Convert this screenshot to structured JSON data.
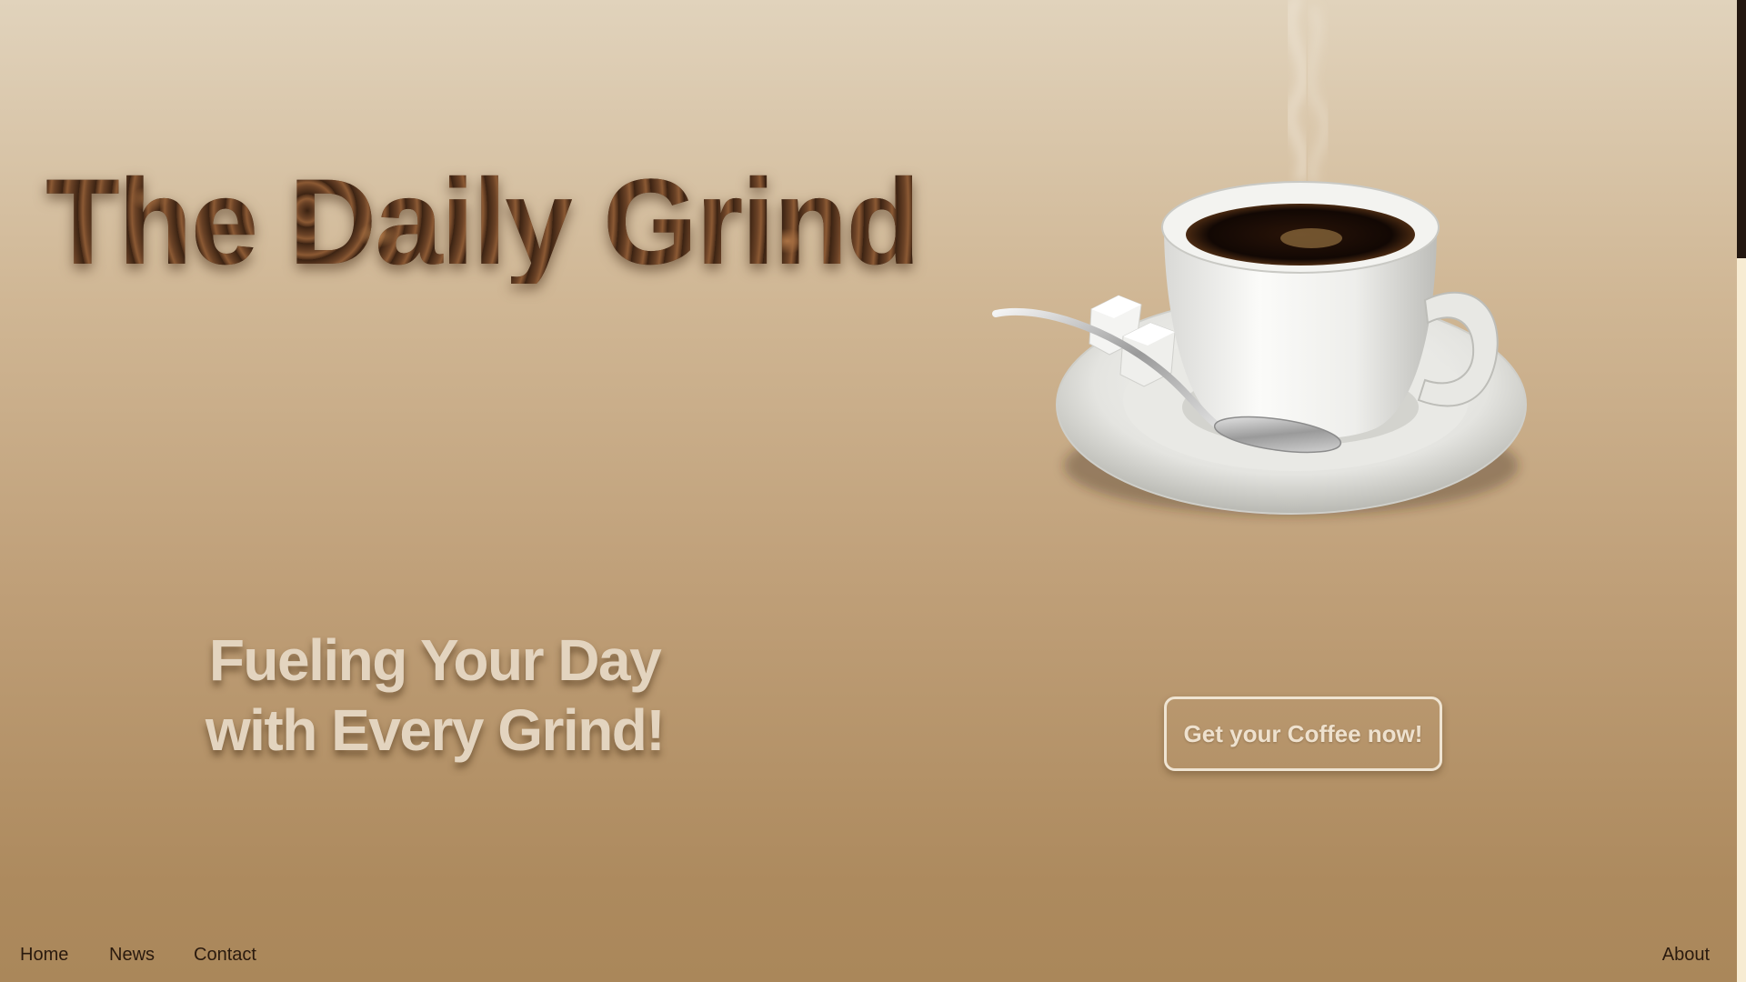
{
  "header": {
    "title": "The Daily Grind"
  },
  "hero": {
    "tagline_line1": "Fueling Your Day",
    "tagline_line2": "with Every Grind!",
    "cta_label": "Get your Coffee now!",
    "image": "coffee-cup-with-saucer-spoon-and-sugar-cubes"
  },
  "nav": {
    "items": [
      {
        "label": "Home"
      },
      {
        "label": "News"
      },
      {
        "label": "Contact"
      },
      {
        "label": "About"
      }
    ]
  },
  "colors": {
    "background_top": "#e1d3bc",
    "background_bottom": "#aa875a",
    "tagline": "#e3d4bf",
    "title_fill": "coffee-bean-texture",
    "nav_text": "#2a1a0e",
    "scrollbar_thumb": "#231710",
    "scrollbar_track": "#f7ecd3"
  }
}
